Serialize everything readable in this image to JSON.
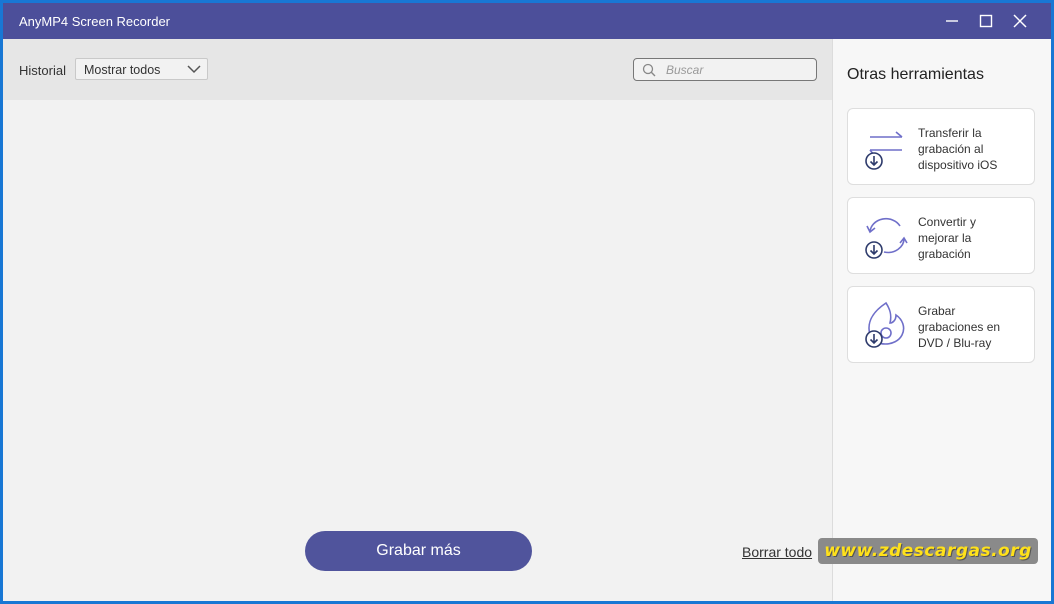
{
  "window": {
    "title": "AnyMP4 Screen Recorder",
    "accent_color": "#4c4f9a",
    "controls": [
      "minimize-icon",
      "maximize-icon",
      "close-icon"
    ]
  },
  "toolbar": {
    "history_label": "Historial",
    "filter_selected": "Mostrar todos",
    "search_placeholder": "Buscar",
    "search_value": ""
  },
  "main": {
    "record_more_label": "Grabar más",
    "clear_all_label": "Borrar todo"
  },
  "sidebar": {
    "title": "Otras herramientas",
    "tools": [
      {
        "label": "Transferir la\ngrabación al\ndispositivo iOS",
        "icon": "transfer-icon"
      },
      {
        "label": "Convertir y\nmejorar la\ngrabación",
        "icon": "convert-icon"
      },
      {
        "label": "Grabar\ngrabaciones en\nDVD / Blu-ray",
        "icon": "disc-burn-icon"
      }
    ]
  },
  "watermark": {
    "text": "www.zdescargas.org",
    "color": "#ffe11a"
  }
}
